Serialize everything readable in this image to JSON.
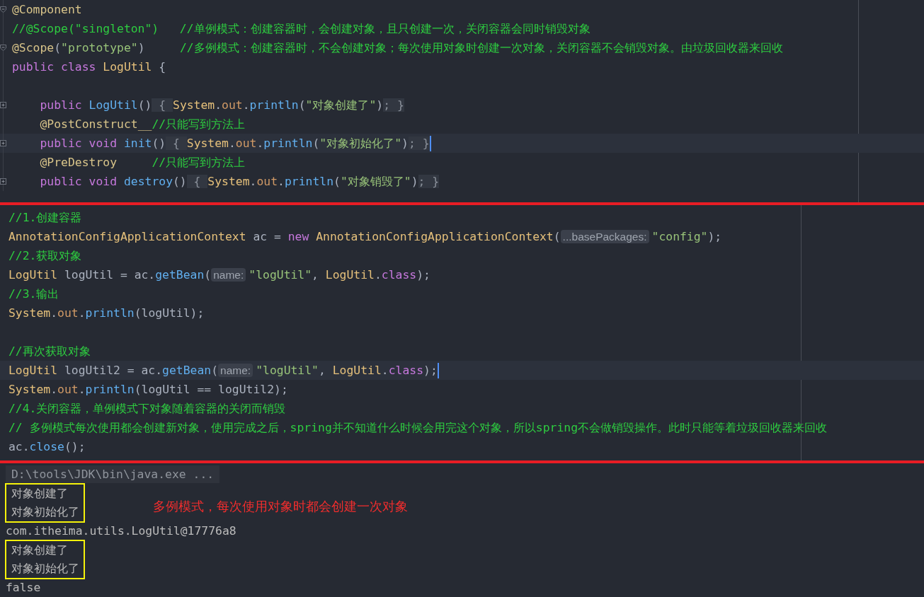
{
  "class_editor": {
    "lines": [
      {
        "current": false,
        "folded": false,
        "tokens": [
          {
            "kind": "annotation",
            "text": "@Component"
          }
        ]
      },
      {
        "current": false,
        "tokens": [
          {
            "kind": "comment",
            "text": "//@Scope(\"singleton\")   //单例模式：创建容器时，会创建对象，且只创建一次，关闭容器会同时销毁对象"
          }
        ]
      },
      {
        "current": false,
        "folded": false,
        "tokens": [
          {
            "kind": "annotation",
            "text": "@Scope"
          },
          {
            "kind": "plain",
            "text": "("
          },
          {
            "kind": "string",
            "text": "\"prototype\""
          },
          {
            "kind": "plain",
            "text": ")     "
          },
          {
            "kind": "comment",
            "text": "//多例模式：创建容器时，不会创建对象；每次使用对象时创建一次对象，关闭容器不会销毁对象。由垃圾回收器来回收"
          }
        ]
      },
      {
        "current": false,
        "tokens": [
          {
            "kind": "keyword",
            "text": "public class "
          },
          {
            "kind": "type",
            "text": "LogUtil "
          },
          {
            "kind": "plain",
            "text": "{"
          }
        ]
      },
      {
        "current": false
      },
      {
        "current": false,
        "folded": true,
        "indented": true,
        "tokens": [
          {
            "kind": "keyword",
            "text": "public "
          },
          {
            "kind": "method",
            "text": "LogUtil"
          },
          {
            "kind": "plain",
            "text": "()"
          },
          {
            "kind": "folded",
            "text": " { "
          },
          {
            "kind": "type",
            "text": "System"
          },
          {
            "kind": "plain",
            "text": "."
          },
          {
            "kind": "field",
            "text": "out"
          },
          {
            "kind": "plain",
            "text": "."
          },
          {
            "kind": "method",
            "text": "println"
          },
          {
            "kind": "plain",
            "text": "("
          },
          {
            "kind": "string",
            "text": "\"对象创建了\""
          },
          {
            "kind": "plain",
            "text": ")"
          },
          {
            "kind": "folded",
            "text": "; }"
          }
        ]
      },
      {
        "current": false,
        "indented": true,
        "tokens": [
          {
            "kind": "annotation",
            "text": "@PostConstruct__"
          },
          {
            "kind": "comment",
            "text": "//只能写到方法上"
          }
        ]
      },
      {
        "current": true,
        "folded": true,
        "indented": true,
        "tokens": [
          {
            "kind": "keyword",
            "text": "public void "
          },
          {
            "kind": "method",
            "text": "init"
          },
          {
            "kind": "plain",
            "text": "()"
          },
          {
            "kind": "folded",
            "text": " { "
          },
          {
            "kind": "type",
            "text": "System"
          },
          {
            "kind": "plain",
            "text": "."
          },
          {
            "kind": "field",
            "text": "out"
          },
          {
            "kind": "plain",
            "text": "."
          },
          {
            "kind": "method",
            "text": "println"
          },
          {
            "kind": "plain",
            "text": "("
          },
          {
            "kind": "string",
            "text": "\"对象初始化了\""
          },
          {
            "kind": "plain",
            "text": ")"
          },
          {
            "kind": "folded",
            "text": "; }"
          }
        ]
      },
      {
        "current": false,
        "indented": true,
        "tokens": [
          {
            "kind": "annotation",
            "text": "@PreDestroy     "
          },
          {
            "kind": "comment",
            "text": "//只能写到方法上"
          }
        ]
      },
      {
        "current": false,
        "folded": true,
        "indented": true,
        "tokens": [
          {
            "kind": "keyword",
            "text": "public void "
          },
          {
            "kind": "method",
            "text": "destroy"
          },
          {
            "kind": "plain",
            "text": "()"
          },
          {
            "kind": "folded",
            "text": " { "
          },
          {
            "kind": "type",
            "text": "System"
          },
          {
            "kind": "plain",
            "text": "."
          },
          {
            "kind": "field",
            "text": "out"
          },
          {
            "kind": "plain",
            "text": "."
          },
          {
            "kind": "method",
            "text": "println"
          },
          {
            "kind": "plain",
            "text": "("
          },
          {
            "kind": "string",
            "text": "\"对象销毁了\""
          },
          {
            "kind": "plain",
            "text": ")"
          },
          {
            "kind": "folded",
            "text": "; }"
          }
        ]
      }
    ]
  },
  "test_editor": {
    "lines": [
      {
        "current": false,
        "tokens": [
          {
            "kind": "comment",
            "text": "//1.创建容器"
          }
        ]
      },
      {
        "current": false,
        "tokens": [
          {
            "kind": "type",
            "text": "AnnotationConfigApplicationContext "
          },
          {
            "kind": "plain",
            "text": "ac = "
          },
          {
            "kind": "keyword",
            "text": "new "
          },
          {
            "kind": "type",
            "text": "AnnotationConfigApplicationContext"
          },
          {
            "kind": "plain",
            "text": "("
          },
          {
            "kind": "hint",
            "text": "...basePackages:"
          },
          {
            "kind": "string",
            "text": "\"config\""
          },
          {
            "kind": "plain",
            "text": ");"
          }
        ]
      },
      {
        "current": false,
        "tokens": [
          {
            "kind": "comment",
            "text": "//2.获取对象"
          }
        ]
      },
      {
        "current": false,
        "tokens": [
          {
            "kind": "type",
            "text": "LogUtil "
          },
          {
            "kind": "plain",
            "text": "logUtil = ac."
          },
          {
            "kind": "method",
            "text": "getBean"
          },
          {
            "kind": "plain",
            "text": "("
          },
          {
            "kind": "hint",
            "text": "name:"
          },
          {
            "kind": "string",
            "text": "\"logUtil\""
          },
          {
            "kind": "plain",
            "text": ", "
          },
          {
            "kind": "type",
            "text": "LogUtil"
          },
          {
            "kind": "plain",
            "text": "."
          },
          {
            "kind": "keyword",
            "text": "class"
          },
          {
            "kind": "plain",
            "text": ");"
          }
        ]
      },
      {
        "current": false,
        "tokens": [
          {
            "kind": "comment",
            "text": "//3.输出"
          }
        ]
      },
      {
        "current": false,
        "tokens": [
          {
            "kind": "type",
            "text": "System"
          },
          {
            "kind": "plain",
            "text": "."
          },
          {
            "kind": "field",
            "text": "out"
          },
          {
            "kind": "plain",
            "text": "."
          },
          {
            "kind": "method",
            "text": "println"
          },
          {
            "kind": "plain",
            "text": "(logUtil);"
          }
        ]
      },
      {
        "current": false
      },
      {
        "current": false,
        "tokens": [
          {
            "kind": "comment",
            "text": "//再次获取对象"
          }
        ]
      },
      {
        "current": true,
        "tokens": [
          {
            "kind": "type",
            "text": "LogUtil "
          },
          {
            "kind": "plain",
            "text": "logUtil2 = ac."
          },
          {
            "kind": "method",
            "text": "getBean"
          },
          {
            "kind": "plain",
            "text": "("
          },
          {
            "kind": "hint",
            "text": "name:"
          },
          {
            "kind": "string",
            "text": "\"logUtil\""
          },
          {
            "kind": "plain",
            "text": ", "
          },
          {
            "kind": "type",
            "text": "LogUtil"
          },
          {
            "kind": "plain",
            "text": "."
          },
          {
            "kind": "keyword",
            "text": "class"
          },
          {
            "kind": "plain",
            "text": ");"
          }
        ]
      },
      {
        "current": false,
        "tokens": [
          {
            "kind": "type",
            "text": "System"
          },
          {
            "kind": "plain",
            "text": "."
          },
          {
            "kind": "field",
            "text": "out"
          },
          {
            "kind": "plain",
            "text": "."
          },
          {
            "kind": "method",
            "text": "println"
          },
          {
            "kind": "plain",
            "text": "(logUtil == logUtil2);"
          }
        ]
      },
      {
        "current": false,
        "tokens": [
          {
            "kind": "comment",
            "text": "//4.关闭容器，单例模式下对象随着容器的关闭而销毁"
          }
        ]
      },
      {
        "current": false,
        "tokens": [
          {
            "kind": "comment",
            "text": "// 多例模式每次使用都会创建新对象，使用完成之后，spring并不知道什么时候会用完这个对象，所以spring不会做销毁操作。此时只能等着垃圾回收器来回收"
          }
        ]
      },
      {
        "current": false,
        "tokens": [
          {
            "kind": "plain",
            "text": "ac."
          },
          {
            "kind": "method",
            "text": "close"
          },
          {
            "kind": "plain",
            "text": "();"
          }
        ]
      }
    ]
  },
  "console": {
    "command": "D:\\tools\\JDK\\bin\\java.exe ...",
    "blocks": [
      {
        "boxed": true,
        "lines": [
          "对象创建了",
          "对象初始化了"
        ],
        "note": "多例模式，每次使用对象时都会创建一次对象"
      },
      {
        "boxed": false,
        "lines": [
          "com.itheima.utils.LogUtil@17776a8"
        ]
      },
      {
        "boxed": true,
        "lines": [
          "对象创建了",
          "对象初始化了"
        ]
      },
      {
        "boxed": false,
        "lines": [
          "false"
        ]
      }
    ]
  }
}
